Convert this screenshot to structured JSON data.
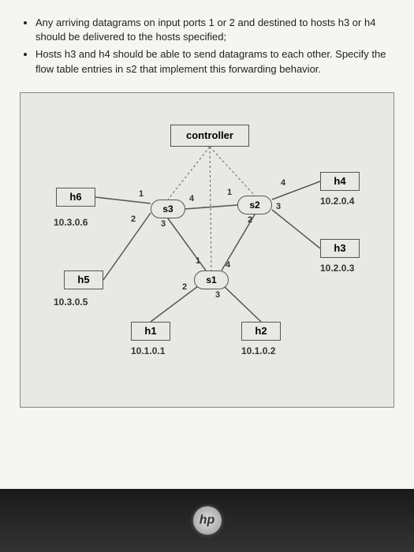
{
  "problem": {
    "bullet1": "Any arriving datagrams on input ports 1 or 2 and destined to hosts h3 or h4 should be delivered to the hosts specified;",
    "bullet2": "Hosts h3 and h4 should be able to send datagrams to each other. Specify the flow table entries in s2 that implement this forwarding behavior."
  },
  "diagram": {
    "controller": "controller",
    "hosts": {
      "h1": {
        "name": "h1",
        "ip": "10.1.0.1"
      },
      "h2": {
        "name": "h2",
        "ip": "10.1.0.2"
      },
      "h3": {
        "name": "h3",
        "ip": "10.2.0.3"
      },
      "h4": {
        "name": "h4",
        "ip": "10.2.0.4"
      },
      "h5": {
        "name": "h5",
        "ip": "10.3.0.5"
      },
      "h6": {
        "name": "h6",
        "ip": "10.3.0.6"
      }
    },
    "switches": {
      "s1": "s1",
      "s2": "s2",
      "s3": "s3"
    },
    "ports": {
      "s3_p1": "1",
      "s3_p2": "2",
      "s3_p3": "3",
      "s3_p4": "4",
      "s2_p1": "1",
      "s2_p2": "2",
      "s2_p3": "3",
      "s2_p4": "4",
      "s1_p1": "1",
      "s1_p2": "2",
      "s1_p3": "3",
      "s1_p4": "4"
    }
  },
  "logo": "hp"
}
